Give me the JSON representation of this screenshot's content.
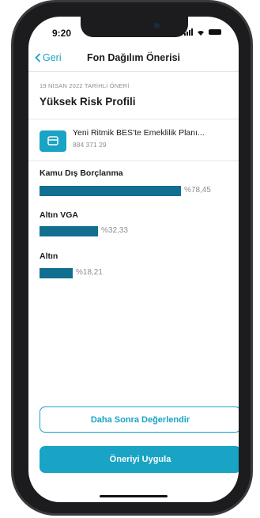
{
  "status_bar": {
    "time": "9:20"
  },
  "navbar": {
    "back_label": "Geri",
    "title": "Fon Dağılım Önerisi"
  },
  "recommendation": {
    "date": "19 NİSAN 2022 TARİHLİ ÖNERİ",
    "profile": "Yüksek Risk Profili"
  },
  "plan": {
    "name": "Yeni Ritmik BES'te Emeklilik Planı...",
    "number": "884 371 29"
  },
  "funds": [
    {
      "name": "Kamu Dış Borçlanma",
      "percent_label": "%78,45",
      "percent": 78.45
    },
    {
      "name": "Altın VGA",
      "percent_label": "%32,33",
      "percent": 32.33
    },
    {
      "name": "Altın",
      "percent_label": "%18,21",
      "percent": 18.21
    }
  ],
  "actions": {
    "later_label": "Daha Sonra Değerlendir",
    "apply_label": "Öneriyi Uygula"
  },
  "colors": {
    "accent": "#19a3c4",
    "bar": "#126f91"
  }
}
